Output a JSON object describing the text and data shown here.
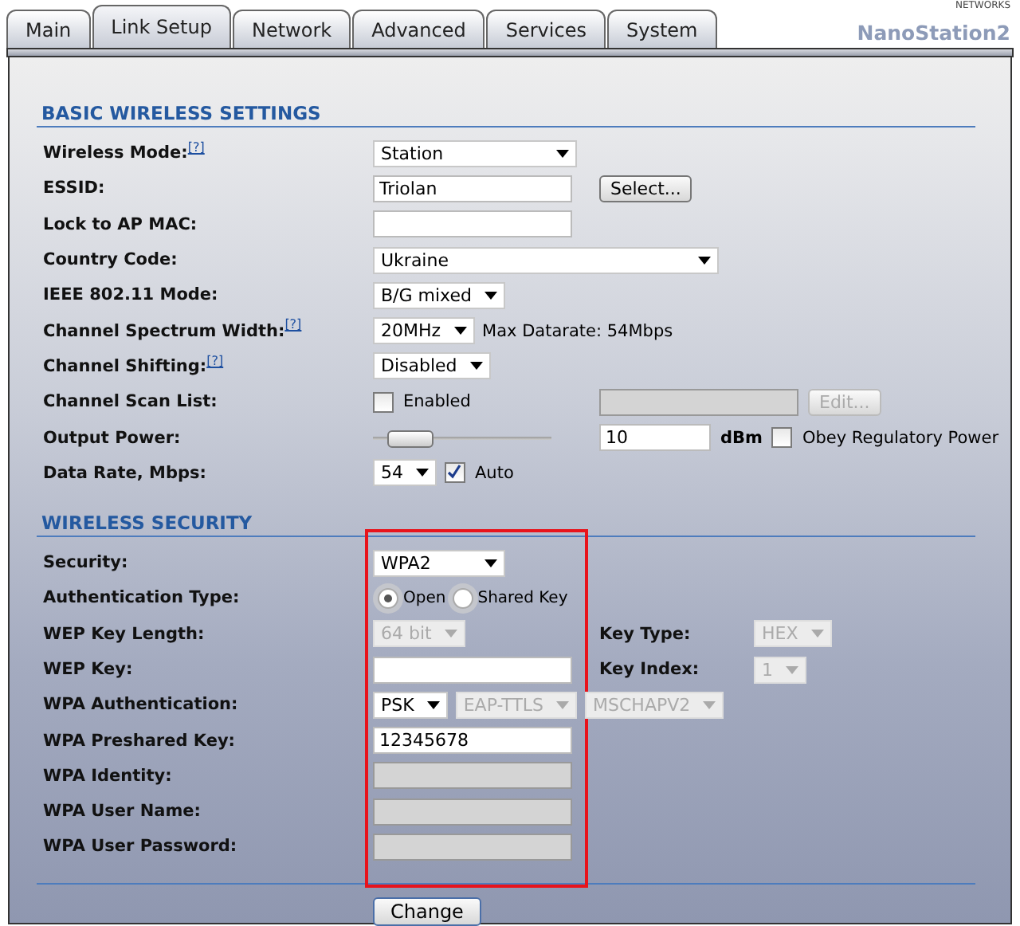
{
  "brand": {
    "tagline": "NETWORKS",
    "model": "NanoStation2"
  },
  "tabs": [
    {
      "label": "Main",
      "selected": false
    },
    {
      "label": "Link Setup",
      "selected": true
    },
    {
      "label": "Network",
      "selected": false
    },
    {
      "label": "Advanced",
      "selected": false
    },
    {
      "label": "Services",
      "selected": false
    },
    {
      "label": "System",
      "selected": false
    }
  ],
  "sections": [
    {
      "title": "BASIC WIRELESS SETTINGS",
      "highlight": false,
      "rows": [
        {
          "label": "Wireless Mode:",
          "help": "[?]",
          "controls": [
            {
              "kind": "select",
              "value": "Station",
              "disabled": false
            }
          ],
          "extra": []
        },
        {
          "label": "ESSID:",
          "controls": [
            {
              "kind": "input",
              "value": "Triolan",
              "disabled": false
            }
          ],
          "extra": [
            {
              "kind": "button",
              "label": "Select...",
              "disabled": false
            }
          ]
        },
        {
          "label": "Lock to AP MAC:",
          "controls": [
            {
              "kind": "input",
              "disabled": false
            }
          ],
          "extra": []
        },
        {
          "label": "Country Code:",
          "controls": [
            {
              "kind": "select",
              "value": "Ukraine",
              "disabled": false
            }
          ],
          "extra": []
        },
        {
          "label": "IEEE 802.11 Mode:",
          "controls": [
            {
              "kind": "select",
              "value": "B/G mixed",
              "disabled": false
            }
          ],
          "extra": []
        },
        {
          "label": "Channel Spectrum Width:",
          "help": "[?]",
          "controls": [
            {
              "kind": "select",
              "value": "20MHz",
              "disabled": false
            },
            {
              "kind": "text",
              "text": "Max Datarate: 54Mbps",
              "bold": false
            }
          ],
          "extra": []
        },
        {
          "label": "Channel Shifting:",
          "help": "[?]",
          "controls": [
            {
              "kind": "select",
              "value": "Disabled",
              "disabled": false
            }
          ],
          "extra": []
        },
        {
          "label": "Channel Scan List:",
          "controls": [
            {
              "kind": "checkbox",
              "label": "Enabled",
              "checked": false,
              "disabled": false
            }
          ],
          "extra": [
            {
              "kind": "input",
              "disabled": true
            },
            {
              "kind": "button",
              "label": "Edit...",
              "disabled": true
            }
          ]
        },
        {
          "label": "Output Power:",
          "controls": [
            {
              "kind": "slider",
              "level": 0.1
            }
          ],
          "extra": [
            {
              "kind": "input",
              "value": "10",
              "disabled": false
            },
            {
              "kind": "text",
              "text": "dBm",
              "bold": true
            },
            {
              "kind": "checkbox",
              "label": "Obey Regulatory Power",
              "checked": false,
              "disabled": false
            }
          ]
        },
        {
          "label": "Data Rate, Mbps:",
          "controls": [
            {
              "kind": "select",
              "value": "54",
              "disabled": false
            },
            {
              "kind": "checkbox",
              "label": "Auto",
              "checked": true,
              "disabled": false
            }
          ],
          "extra": []
        }
      ]
    },
    {
      "title": "WIRELESS SECURITY",
      "highlight": true,
      "rows": [
        {
          "label": "Security:",
          "controls": [
            {
              "kind": "select",
              "value": "WPA2",
              "disabled": false
            }
          ],
          "extra": []
        },
        {
          "label": "Authentication Type:",
          "controls": [
            {
              "kind": "radio",
              "disabled": true,
              "options": [
                {
                  "label": "Open",
                  "selected": true
                },
                {
                  "label": "Shared Key",
                  "selected": false
                }
              ]
            }
          ],
          "extra": []
        },
        {
          "label": "WEP Key Length:",
          "controls": [
            {
              "kind": "select",
              "value": "64 bit",
              "disabled": true
            }
          ],
          "extra": [
            {
              "kind": "label",
              "text": "Key Type:"
            },
            {
              "kind": "select",
              "value": "HEX",
              "disabled": true
            }
          ]
        },
        {
          "label": "WEP Key:",
          "controls": [
            {
              "kind": "input",
              "disabled": false
            }
          ],
          "extra": [
            {
              "kind": "label",
              "text": "Key Index:"
            },
            {
              "kind": "select",
              "value": "1",
              "disabled": true
            }
          ]
        },
        {
          "label": "WPA Authentication:",
          "controls": [
            {
              "kind": "select",
              "value": "PSK",
              "disabled": false
            },
            {
              "kind": "select",
              "value": "EAP-TTLS",
              "disabled": true
            },
            {
              "kind": "select",
              "value": "MSCHAPV2",
              "disabled": true
            }
          ],
          "extra": []
        },
        {
          "label": "WPA Preshared Key:",
          "controls": [
            {
              "kind": "input",
              "value": "12345678",
              "disabled": false
            }
          ],
          "extra": []
        },
        {
          "label": "WPA Identity:",
          "controls": [
            {
              "kind": "input",
              "disabled": true
            }
          ],
          "extra": []
        },
        {
          "label": "WPA User Name:",
          "controls": [
            {
              "kind": "input",
              "disabled": true
            }
          ],
          "extra": []
        },
        {
          "label": "WPA User Password:",
          "controls": [
            {
              "kind": "input",
              "disabled": true
            }
          ],
          "extra": []
        }
      ]
    }
  ],
  "submit": {
    "label": "Change"
  }
}
